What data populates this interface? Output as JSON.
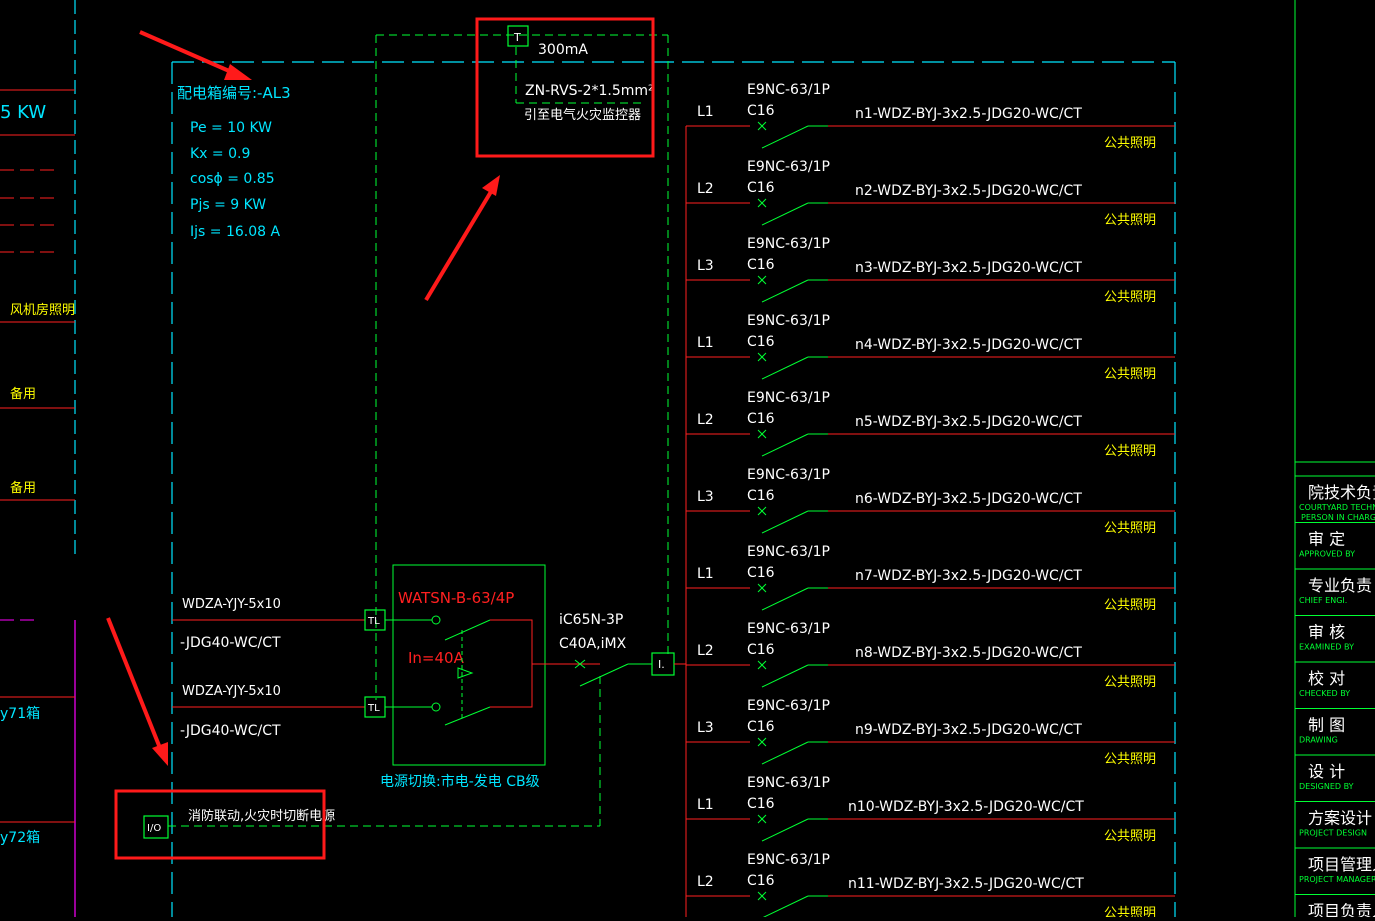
{
  "left_panel": {
    "kw": "5 KW",
    "fan_room": "风机房照明",
    "spare1": "备用",
    "spare2": "备用",
    "y71": "y71箱",
    "y72": "y72箱"
  },
  "box_info": {
    "label": "配电箱编号:-AL3",
    "pe": "Pe = 10  KW",
    "kx": "Kx = 0.9",
    "cos": "cosϕ = 0.85",
    "pjs": "Pjs = 9  KW",
    "ijs": "Ijs = 16.08  A"
  },
  "monitor": {
    "symbol": "T",
    "current": "300mA",
    "cable": "ZN-RVS-2*1.5mm²",
    "desc": "引至电气火灾监控器"
  },
  "incoming": {
    "cable1_a": "WDZA-YJY-5x10",
    "cable1_b": "-JDG40-WC/CT",
    "cable2_a": "WDZA-YJY-5x10",
    "cable2_b": "-JDG40-WC/CT",
    "tl1": "TL",
    "tl2": "TL",
    "atse_model": "WATSN-B-63/4P",
    "atse_in": "In=40A",
    "atse_desc": "电源切换:市电-发电  CB级",
    "breaker_model": "iC65N-3P",
    "breaker_rating": "C40A,iMX",
    "i_box": "I."
  },
  "fire": {
    "io": "I/O",
    "desc": "消防联动,火灾时切断电源"
  },
  "circuits": [
    {
      "phase": "L1",
      "breaker": "E9NC-63/1P",
      "curve": "C16",
      "cable": "n1-WDZ-BYJ-3x2.5-JDG20-WC/CT",
      "use": "公共照明"
    },
    {
      "phase": "L2",
      "breaker": "E9NC-63/1P",
      "curve": "C16",
      "cable": "n2-WDZ-BYJ-3x2.5-JDG20-WC/CT",
      "use": "公共照明"
    },
    {
      "phase": "L3",
      "breaker": "E9NC-63/1P",
      "curve": "C16",
      "cable": "n3-WDZ-BYJ-3x2.5-JDG20-WC/CT",
      "use": "公共照明"
    },
    {
      "phase": "L1",
      "breaker": "E9NC-63/1P",
      "curve": "C16",
      "cable": "n4-WDZ-BYJ-3x2.5-JDG20-WC/CT",
      "use": "公共照明"
    },
    {
      "phase": "L2",
      "breaker": "E9NC-63/1P",
      "curve": "C16",
      "cable": "n5-WDZ-BYJ-3x2.5-JDG20-WC/CT",
      "use": "公共照明"
    },
    {
      "phase": "L3",
      "breaker": "E9NC-63/1P",
      "curve": "C16",
      "cable": "n6-WDZ-BYJ-3x2.5-JDG20-WC/CT",
      "use": "公共照明"
    },
    {
      "phase": "L1",
      "breaker": "E9NC-63/1P",
      "curve": "C16",
      "cable": "n7-WDZ-BYJ-3x2.5-JDG20-WC/CT",
      "use": "公共照明"
    },
    {
      "phase": "L2",
      "breaker": "E9NC-63/1P",
      "curve": "C16",
      "cable": "n8-WDZ-BYJ-3x2.5-JDG20-WC/CT",
      "use": "公共照明"
    },
    {
      "phase": "L3",
      "breaker": "E9NC-63/1P",
      "curve": "C16",
      "cable": "n9-WDZ-BYJ-3x2.5-JDG20-WC/CT",
      "use": "公共照明"
    },
    {
      "phase": "L1",
      "breaker": "E9NC-63/1P",
      "curve": "C16",
      "cable": "n10-WDZ-BYJ-3x2.5-JDG20-WC/CT",
      "use": "公共照明"
    },
    {
      "phase": "L2",
      "breaker": "E9NC-63/1P",
      "curve": "C16",
      "cable": "n11-WDZ-BYJ-3x2.5-JDG20-WC/CT",
      "use": "公共照明"
    }
  ],
  "title_block": [
    {
      "cn": "院技术负责人",
      "en": "COURTYARD TECHNOLOGY",
      "en2": "PERSON IN CHARGE"
    },
    {
      "cn": "审 定",
      "en": "APPROVED BY",
      "en2": ""
    },
    {
      "cn": "专业负责",
      "en": "CHIEF ENGI.",
      "en2": ""
    },
    {
      "cn": "审 核",
      "en": "EXAMINED BY",
      "en2": ""
    },
    {
      "cn": "校 对",
      "en": "CHECKED BY",
      "en2": ""
    },
    {
      "cn": "制 图",
      "en": "DRAWING",
      "en2": ""
    },
    {
      "cn": "设 计",
      "en": "DESIGNED BY",
      "en2": ""
    },
    {
      "cn": "方案设计",
      "en": "PROJECT DESIGN",
      "en2": ""
    },
    {
      "cn": "项目管理人",
      "en": "PROJECT MANAGER",
      "en2": ""
    },
    {
      "cn": "项目负责人",
      "en": "",
      "en2": ""
    }
  ]
}
